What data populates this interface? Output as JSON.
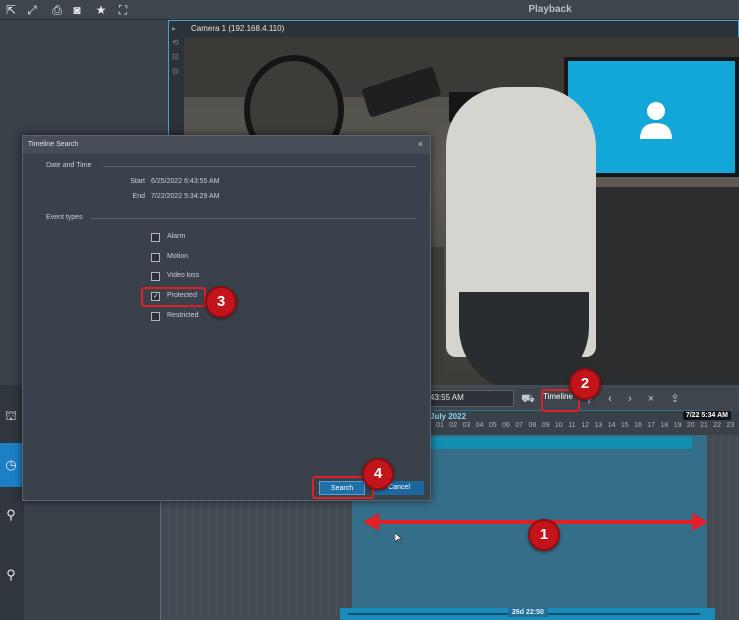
{
  "app": {
    "title": "Playback"
  },
  "toolbar": {
    "icons": [
      "arrow-icon",
      "expand-icon",
      "print-icon",
      "camera-icon",
      "star-icon",
      "fullscreen-icon"
    ]
  },
  "video": {
    "camera_label": "Camera 1 (192.168.4.110)"
  },
  "timeline": {
    "current_time": "43:55 AM",
    "timeline_button": "Timeline",
    "month_label": "July 2022",
    "end_badge": "7/22 5:34 AM",
    "days": [
      "01",
      "02",
      "03",
      "04",
      "05",
      "06",
      "07",
      "08",
      "09",
      "10",
      "11",
      "12",
      "13",
      "14",
      "15",
      "16",
      "17",
      "18",
      "19",
      "20",
      "21",
      "22",
      "23",
      "2"
    ],
    "duration": "26d 22:50"
  },
  "dialog": {
    "title": "Timeline Search",
    "date_section": "Date and Time",
    "start_label": "Start",
    "start_value": "6/25/2022 6:43:55 AM",
    "end_label": "End",
    "end_value": "7/22/2022 5:34:29 AM",
    "event_section": "Event types",
    "events": [
      {
        "label": "Alarm",
        "checked": false
      },
      {
        "label": "Motion",
        "checked": false
      },
      {
        "label": "Video loss",
        "checked": false
      },
      {
        "label": "Protected",
        "checked": true
      },
      {
        "label": "Restricted",
        "checked": false
      }
    ],
    "search_label": "Search",
    "cancel_label": "Cancel",
    "close_glyph": "×"
  },
  "annotations": {
    "n1": "1",
    "n2": "2",
    "n3": "3",
    "n4": "4",
    "color": "#e01f26"
  }
}
